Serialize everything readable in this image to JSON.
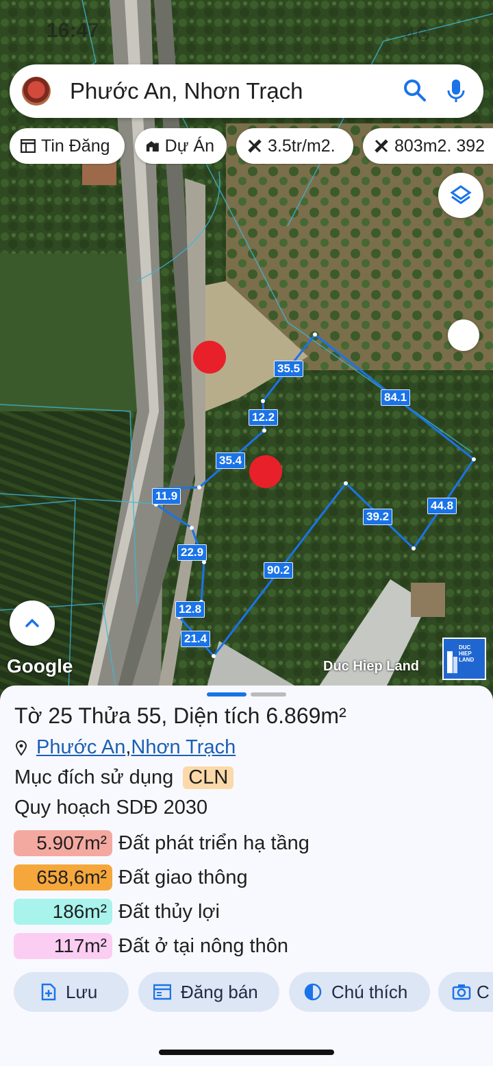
{
  "status": {
    "time": "16:47",
    "network": "4G"
  },
  "search": {
    "query": "Phước An, Nhơn Trạch"
  },
  "chips": [
    {
      "label": "Tin Đăng",
      "icon": "listing-icon"
    },
    {
      "label": "Dự Án",
      "icon": "buildings-icon"
    },
    {
      "label": "3.5tr/m2.",
      "icon": "ruler-icon"
    },
    {
      "label": "803m2. 392",
      "icon": "ruler-icon"
    }
  ],
  "map": {
    "edge_labels": [
      "35.5",
      "84.1",
      "12.2",
      "35.4",
      "44.8",
      "11.9",
      "39.2",
      "22.9",
      "90.2",
      "12.8",
      "21.4"
    ],
    "attribution": "Google",
    "watermark": "Duc Hiep Land",
    "watermark_logo": "DUC HIEP LAND",
    "colors": {
      "parcel_line": "#1a73e8",
      "marker": "#e8202a"
    }
  },
  "parcel": {
    "title_prefix": "Tờ ",
    "sheet_no": "25",
    "parcel_word": " Thửa ",
    "parcel_no": "55",
    "area_text": ", Diện tích ",
    "area_value": "6.869m²",
    "location": [
      "Phước An",
      "Nhơn Trạch"
    ],
    "location_sep": ", ",
    "purpose_label": "Mục đích sử dụng",
    "purpose_code": "CLN",
    "plan_label": "Quy hoạch SDĐ 2030",
    "zoning": [
      {
        "area": "5.907m²",
        "label": "Đất phát triển hạ tầng",
        "color": "#f4a9a0"
      },
      {
        "area": "658,6m²",
        "label": "Đất giao thông",
        "color": "#f5a73b"
      },
      {
        "area": "186m²",
        "label": "Đất thủy lợi",
        "color": "#a8f3ec"
      },
      {
        "area": "117m²",
        "label": "Đất ở tại nông thôn",
        "color": "#fbcdf2"
      }
    ]
  },
  "actions": [
    {
      "label": "Lưu",
      "icon": "save-icon"
    },
    {
      "label": "Đăng bán",
      "icon": "post-icon"
    },
    {
      "label": "Chú thích",
      "icon": "legend-icon"
    },
    {
      "label": "C",
      "icon": "camera-icon"
    }
  ]
}
